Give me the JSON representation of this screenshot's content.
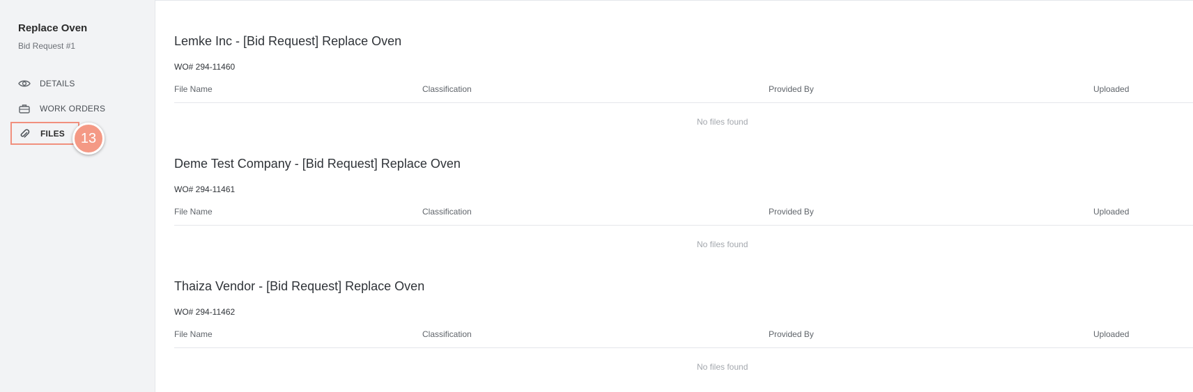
{
  "sidebar": {
    "title": "Replace Oven",
    "subtitle": "Bid Request #1",
    "items": [
      {
        "label": "DETAILS",
        "icon": "eye-icon"
      },
      {
        "label": "WORK ORDERS",
        "icon": "briefcase-icon"
      },
      {
        "label": "FILES",
        "icon": "paperclip-icon"
      }
    ],
    "step_badge": "13"
  },
  "columns": {
    "file_name": "File Name",
    "classification": "Classification",
    "provided_by": "Provided By",
    "uploaded": "Uploaded"
  },
  "sections": [
    {
      "title": "Lemke Inc - [Bid Request] Replace Oven",
      "wo": "WO# 294-11460",
      "empty_text": "No files found"
    },
    {
      "title": "Deme Test Company - [Bid Request] Replace Oven",
      "wo": "WO# 294-11461",
      "empty_text": "No files found"
    },
    {
      "title": "Thaiza Vendor - [Bid Request] Replace Oven",
      "wo": "WO# 294-11462",
      "empty_text": "No files found"
    }
  ],
  "colors": {
    "highlight_border": "#f18f7d",
    "badge_bg": "#f49985",
    "sidebar_bg": "#f2f3f5"
  }
}
